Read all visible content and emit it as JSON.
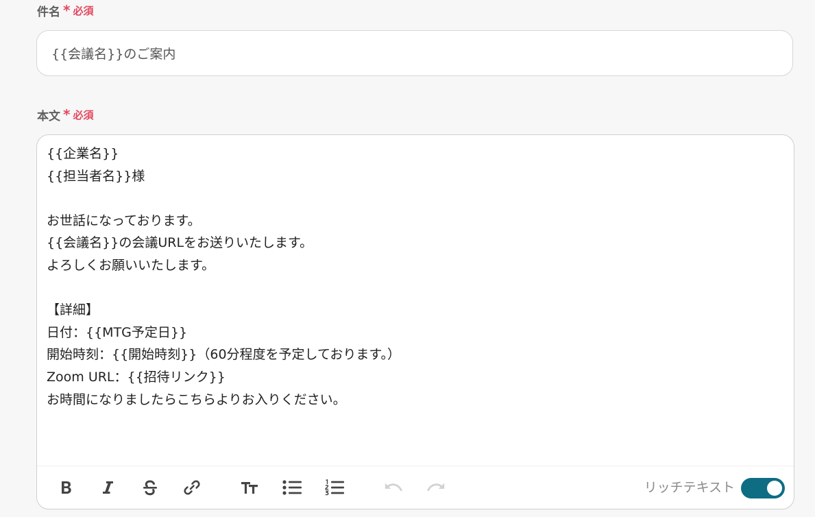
{
  "subject_field": {
    "label": "件名",
    "asterisk": "*",
    "required_label": "必須",
    "value": "{{会議名}}のご案内"
  },
  "body_field": {
    "label": "本文",
    "asterisk": "*",
    "required_label": "必須",
    "lines": [
      "{{企業名}}",
      "{{担当者名}}様",
      "",
      "お世話になっております。",
      "{{会議名}}の会議URLをお送りいたします。",
      "よろしくお願いいたします。",
      "",
      "【詳細】",
      "日付：{{MTG予定日}}",
      "開始時刻：{{開始時刻}}（60分程度を予定しております。）",
      "Zoom URL：{{招待リンク}}",
      "お時間になりましたらこちらよりお入りください。"
    ]
  },
  "toolbar": {
    "buttons": [
      {
        "name": "bold-button",
        "icon": "bold-icon",
        "enabled": true
      },
      {
        "name": "italic-button",
        "icon": "italic-icon",
        "enabled": true
      },
      {
        "name": "strikethrough-button",
        "icon": "strikethrough-icon",
        "enabled": true
      },
      {
        "name": "link-button",
        "icon": "link-icon",
        "enabled": true
      },
      {
        "name": "text-size-button",
        "icon": "text-size-icon",
        "enabled": true
      },
      {
        "name": "bullet-list-button",
        "icon": "bullet-list-icon",
        "enabled": true
      },
      {
        "name": "numbered-list-button",
        "icon": "numbered-list-icon",
        "enabled": true
      },
      {
        "name": "undo-button",
        "icon": "undo-icon",
        "enabled": false
      },
      {
        "name": "redo-button",
        "icon": "redo-icon",
        "enabled": false
      }
    ],
    "rich_text_label": "リッチテキスト",
    "rich_text_enabled": true
  },
  "colors": {
    "required": "#e2475f",
    "toggle_on": "#0e6d83",
    "label": "#5f5f5f",
    "disabled_icon": "#d2d2d2"
  }
}
